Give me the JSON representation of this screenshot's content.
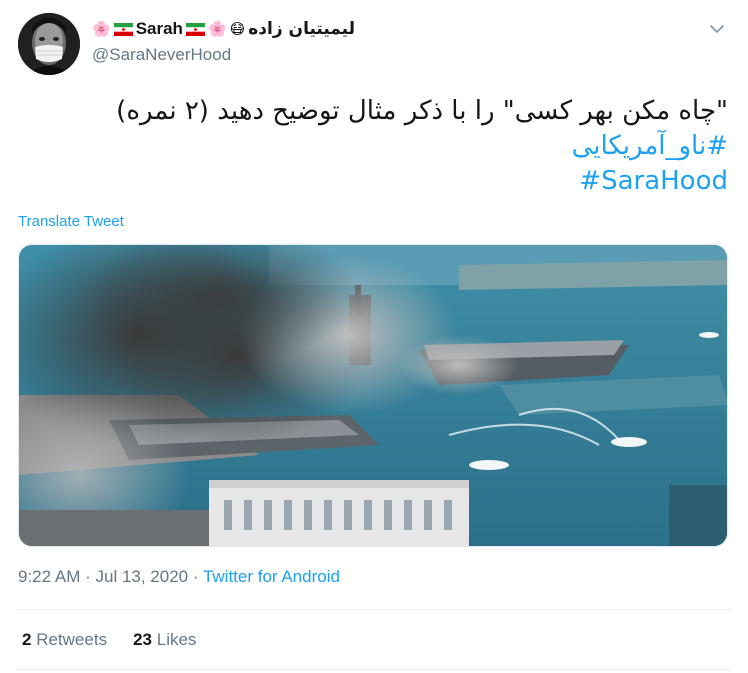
{
  "author": {
    "display_name_fa": "لیمیتیان زاده",
    "display_name_en": "Sarah",
    "handle": "@SaraNeverHood",
    "emoji_mask": "😷",
    "emoji_flower": "🌸",
    "flag_icon": "iran-flag-icon"
  },
  "tweet": {
    "line1": "\"چاه مکن بهر کسی\" را با ذکر مثال توضیح دهید (۲ نمره)",
    "hashtag1": "#ناو_آمریکایی",
    "hashtag2": "#SaraHood",
    "translate_label": "Translate Tweet"
  },
  "meta": {
    "time": "9:22 AM",
    "separator": " · ",
    "date": "Jul 13, 2020",
    "source": "Twitter for Android"
  },
  "stats": {
    "retweets_count": "2",
    "retweets_label": "Retweets",
    "likes_count": "23",
    "likes_label": "Likes"
  },
  "colors": {
    "accent": "#1da1f2",
    "text": "#14171a",
    "muted": "#657786",
    "divider": "#e6ecf0"
  }
}
